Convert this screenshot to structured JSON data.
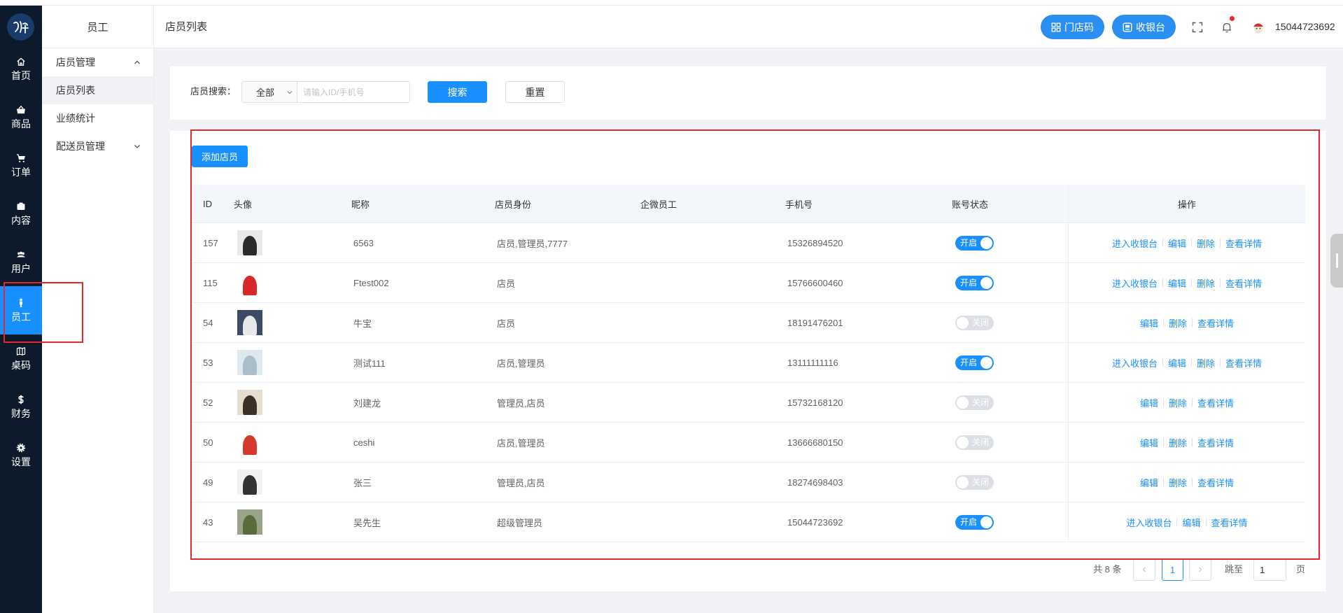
{
  "colors": {
    "primary": "#1890ff",
    "sidebar": "#0c1a2b",
    "highlight": "#e5262c"
  },
  "sidebar": {
    "items": [
      {
        "label": "首页",
        "icon": "home-icon"
      },
      {
        "label": "商品",
        "icon": "shop-icon"
      },
      {
        "label": "订单",
        "icon": "cart-icon"
      },
      {
        "label": "内容",
        "icon": "content-icon"
      },
      {
        "label": "用户",
        "icon": "users-icon"
      },
      {
        "label": "员工",
        "icon": "staff-icon",
        "active": true
      },
      {
        "label": "桌码",
        "icon": "map-icon"
      },
      {
        "label": "财务",
        "icon": "dollar-icon"
      },
      {
        "label": "设置",
        "icon": "gear-icon"
      }
    ]
  },
  "subnav": {
    "title": "员工",
    "items": [
      {
        "label": "店员管理"
      },
      {
        "label": "店员列表",
        "active": true
      },
      {
        "label": "业绩统计"
      },
      {
        "label": "配送员管理"
      }
    ]
  },
  "header": {
    "title": "店员列表",
    "store_code_label": "门店码",
    "cashier_label": "收银台",
    "username": "15044723692"
  },
  "search": {
    "label": "店员搜索：",
    "select_value": "全部",
    "input_placeholder": "请输入ID/手机号",
    "search_label": "搜索",
    "reset_label": "重置"
  },
  "table": {
    "add_label": "添加店员",
    "columns": [
      "ID",
      "头像",
      "昵称",
      "店员身份",
      "企微员工",
      "手机号",
      "账号状态",
      "操作"
    ],
    "rows": [
      {
        "id": "157",
        "avatar_bg": "#e9e9e9",
        "avatar_fg": "#2a2a2a",
        "nickname": "6563",
        "role": "店员,管理员,7777",
        "wecom": "",
        "phone": "15326894520",
        "enabled": true,
        "status_label": "开启",
        "actions": [
          "进入收银台",
          "编辑",
          "删除",
          "查看详情"
        ]
      },
      {
        "id": "115",
        "avatar_bg": "#ffffff",
        "avatar_fg": "#d8282a",
        "nickname": "Ftest002",
        "role": "店员",
        "wecom": "",
        "phone": "15766600460",
        "enabled": true,
        "status_label": "开启",
        "actions": [
          "进入收银台",
          "编辑",
          "删除",
          "查看详情"
        ]
      },
      {
        "id": "54",
        "avatar_bg": "#3c4a66",
        "avatar_fg": "#e8e8e8",
        "nickname": "牛宝",
        "role": "店员",
        "wecom": "",
        "phone": "18191476201",
        "enabled": false,
        "status_label": "关闭",
        "actions": [
          "编辑",
          "删除",
          "查看详情"
        ]
      },
      {
        "id": "53",
        "avatar_bg": "#dde8ef",
        "avatar_fg": "#aabdca",
        "nickname": "测试111",
        "role": "店员,管理员",
        "wecom": "",
        "phone": "13111111116",
        "enabled": true,
        "status_label": "开启",
        "actions": [
          "进入收银台",
          "编辑",
          "删除",
          "查看详情"
        ]
      },
      {
        "id": "52",
        "avatar_bg": "#e6ddd0",
        "avatar_fg": "#3a3027",
        "nickname": "刘建龙",
        "role": "管理员,店员",
        "wecom": "",
        "phone": "15732168120",
        "enabled": false,
        "status_label": "关闭",
        "actions": [
          "编辑",
          "删除",
          "查看详情"
        ]
      },
      {
        "id": "50",
        "avatar_bg": "#ffffff",
        "avatar_fg": "#d6392b",
        "nickname": "ceshi",
        "role": "店员,管理员",
        "wecom": "",
        "phone": "13666680150",
        "enabled": false,
        "status_label": "关闭",
        "actions": [
          "编辑",
          "删除",
          "查看详情"
        ]
      },
      {
        "id": "49",
        "avatar_bg": "#f2f2f2",
        "avatar_fg": "#333333",
        "nickname": "张三",
        "role": "管理员,店员",
        "wecom": "",
        "phone": "18274698403",
        "enabled": false,
        "status_label": "关闭",
        "actions": [
          "编辑",
          "删除",
          "查看详情"
        ]
      },
      {
        "id": "43",
        "avatar_bg": "#9aa48a",
        "avatar_fg": "#5a6b3e",
        "nickname": "吴先生",
        "role": "超级管理员",
        "wecom": "",
        "phone": "15044723692",
        "enabled": true,
        "status_label": "开启",
        "actions": [
          "进入收银台",
          "编辑",
          "查看详情"
        ]
      }
    ]
  },
  "pagination": {
    "total_text": "共 8 条",
    "current_page": "1",
    "jump_label": "跳至",
    "jump_value": "1",
    "page_suffix": "页"
  }
}
